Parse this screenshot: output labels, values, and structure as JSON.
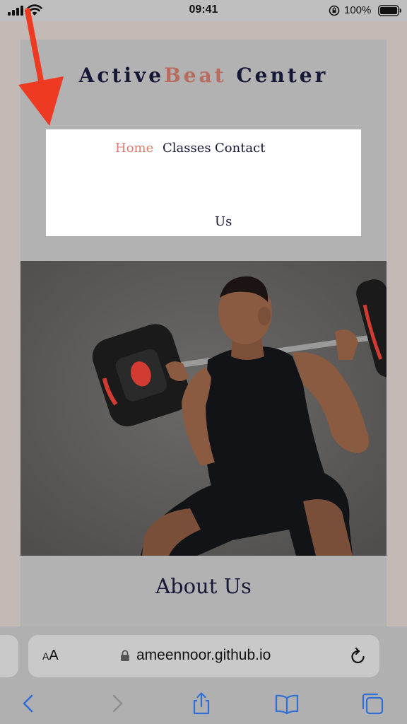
{
  "status_bar": {
    "time": "09:41",
    "battery_percent": "100%",
    "icons": [
      "signal-icon",
      "wifi-icon",
      "orientation-lock-icon",
      "battery-icon"
    ]
  },
  "site": {
    "title_part1": "Active",
    "title_part2": "Beat",
    "title_part3": " Center",
    "nav": {
      "home": "Home",
      "classes": "Classes",
      "contact_line1": "Contact",
      "contact_line2": "Us"
    },
    "hero_image": "man-lifting-barbell-photo",
    "about_heading": "About Us"
  },
  "browser": {
    "aa_label_small": "A",
    "aa_label_large": "A",
    "url": "ameennoor.github.io",
    "toolbar_icons": [
      "back-icon",
      "forward-icon",
      "share-icon",
      "bookmarks-icon",
      "tabs-icon"
    ]
  },
  "colors": {
    "title_navy": "#161838",
    "title_accent": "#b86b5f",
    "nav_active": "#dc7e6d",
    "annotation_arrow": "#ee3a22",
    "ios_blue": "#2f6fd6"
  }
}
